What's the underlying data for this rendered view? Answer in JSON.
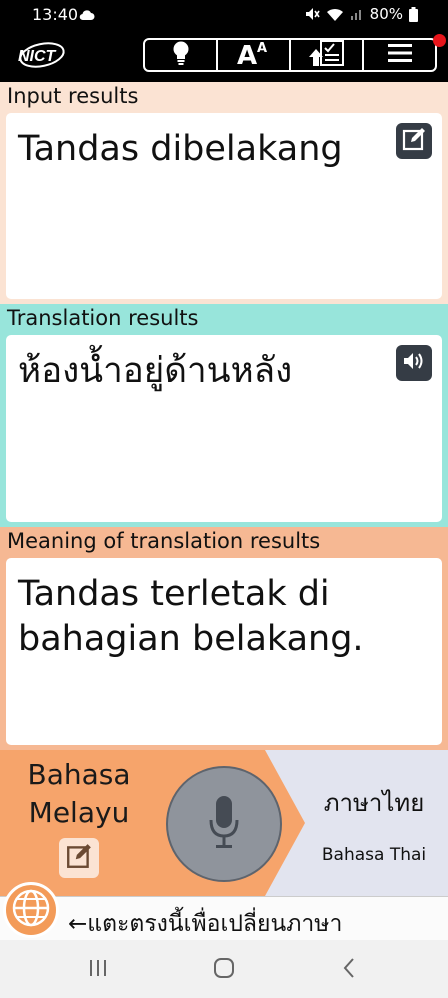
{
  "status_bar": {
    "time": "13:40",
    "battery": "80%",
    "icons": [
      "cloud-icon",
      "mute-icon",
      "wifi-icon",
      "signal-icon",
      "battery-icon"
    ]
  },
  "header": {
    "logo_text": "NICT",
    "toolbar": [
      "hint-bulb-icon",
      "font-size-icon",
      "history-upload-icon",
      "menu-icon"
    ],
    "notification_color": "#e8151b"
  },
  "input_panel": {
    "label": "Input results",
    "text": "Tandas dibelakang",
    "bg_color": "#fbe3d3"
  },
  "translation_panel": {
    "label": "Translation results",
    "text": "ห้องน้ำอยู่ด้านหลัง",
    "bg_color": "#98e5db"
  },
  "meaning_panel": {
    "label": "Meaning of translation results",
    "text": "Tandas terletak di bahagian belakang.",
    "bg_color": "#f6b893"
  },
  "languages": {
    "source": "Bahasa Melayu",
    "target_native": "ภาษาไทย",
    "target": "Bahasa Thai"
  },
  "change_language_hint": "←แตะตรงนี้เพื่อเปลี่ยนภาษา",
  "nav_bar": [
    "recent-apps-icon",
    "home-icon",
    "back-icon"
  ]
}
